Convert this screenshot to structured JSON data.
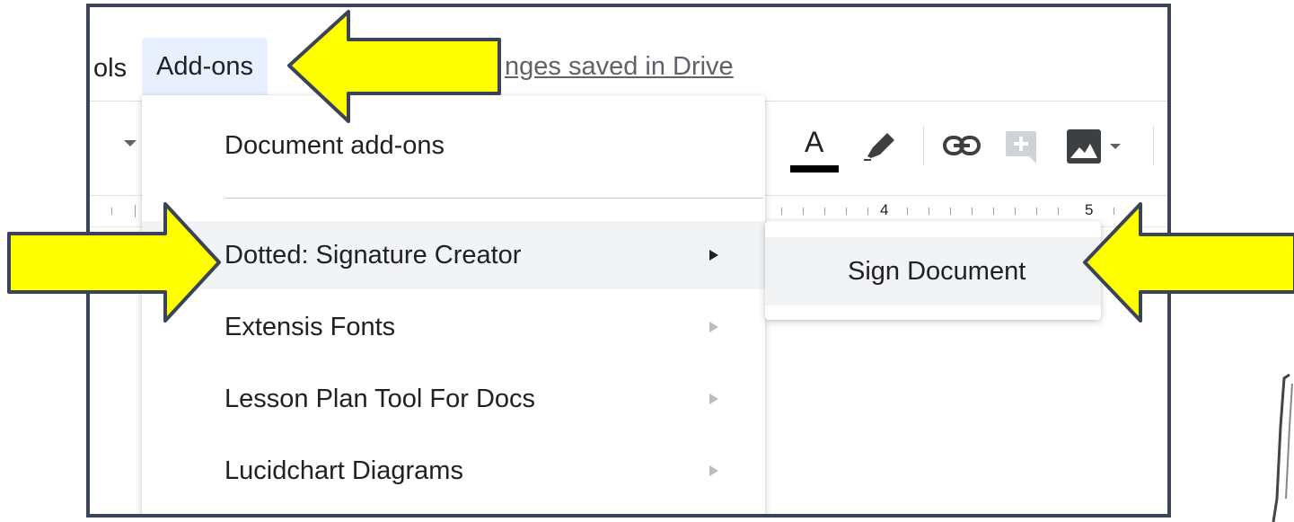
{
  "menubar": {
    "tools_label_partial": "ols",
    "addons_label": "Add-ons",
    "saved_text": "nges saved in Drive"
  },
  "ruler": {
    "number_4": "4",
    "number_5": "5"
  },
  "addons_menu": {
    "items": [
      {
        "label": "Document add-ons",
        "has_submenu": false
      },
      {
        "label": "Dotted: Signature Creator",
        "has_submenu": true,
        "highlighted": true
      },
      {
        "label": "Extensis Fonts",
        "has_submenu": true
      },
      {
        "label": "Lesson Plan Tool For Docs",
        "has_submenu": true
      },
      {
        "label": "Lucidchart Diagrams",
        "has_submenu": true
      }
    ]
  },
  "submenu": {
    "items": [
      {
        "label": "Sign Document",
        "highlighted": true
      }
    ]
  },
  "toolbar": {
    "text_color_letter": "A"
  },
  "colors": {
    "callout_fill": "#ffff00",
    "callout_stroke": "#3a4456",
    "menu_hover": "#f1f3f4",
    "addons_active_bg": "#e8f0fe"
  }
}
